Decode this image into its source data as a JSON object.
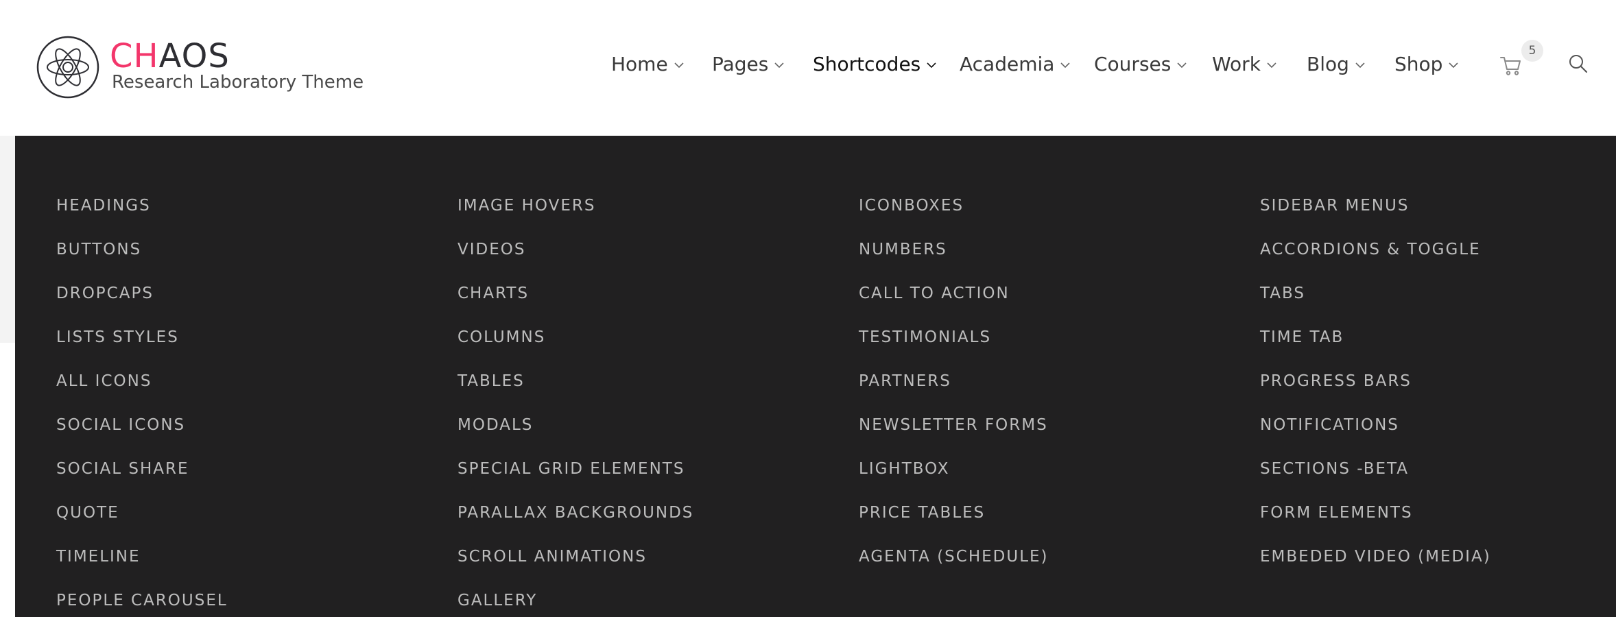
{
  "brand": {
    "accent": "CH",
    "rest": "AOS",
    "tagline": "Research Laboratory Theme"
  },
  "nav": {
    "items": [
      {
        "label": "Home"
      },
      {
        "label": "Pages"
      },
      {
        "label": "Shortcodes",
        "active": true
      },
      {
        "label": "Academia"
      },
      {
        "label": "Courses"
      },
      {
        "label": "Work"
      },
      {
        "label": "Blog"
      },
      {
        "label": "Shop"
      }
    ],
    "cart_count": "5",
    "icons": {
      "cart": "cart-icon",
      "search": "search-icon",
      "caret": "chevron-down-icon"
    }
  },
  "mega_menu": {
    "columns": [
      [
        "HEADINGS",
        "BUTTONS",
        "DROPCAPS",
        "LISTS STYLES",
        "ALL ICONS",
        "SOCIAL ICONS",
        "SOCIAL SHARE",
        "QUOTE",
        "TIMELINE",
        "PEOPLE CAROUSEL"
      ],
      [
        "IMAGE HOVERS",
        "VIDEOS",
        "CHARTS",
        "COLUMNS",
        "TABLES",
        "MODALS",
        "SPECIAL GRID ELEMENTS",
        "PARALLAX BACKGROUNDS",
        "SCROLL ANIMATIONS",
        "GALLERY"
      ],
      [
        "ICONBOXES",
        "NUMBERS",
        "CALL TO ACTION",
        "TESTIMONIALS",
        "PARTNERS",
        "NEWSLETTER FORMS",
        "LIGHTBOX",
        "PRICE TABLES",
        "AGENTA (SCHEDULE)"
      ],
      [
        "SIDEBAR MENUS",
        "ACCORDIONS & TOGGLE",
        "TABS",
        "TIME TAB",
        "PROGRESS BARS",
        "NOTIFICATIONS",
        "SECTIONS -BETA",
        "FORM ELEMENTS",
        "EMBEDED VIDEO (MEDIA)"
      ]
    ]
  },
  "colors": {
    "accent": "#f3366b",
    "menu_bg": "#212021",
    "menu_text": "#bdbdbd",
    "nav_text": "#3a3a3a"
  }
}
